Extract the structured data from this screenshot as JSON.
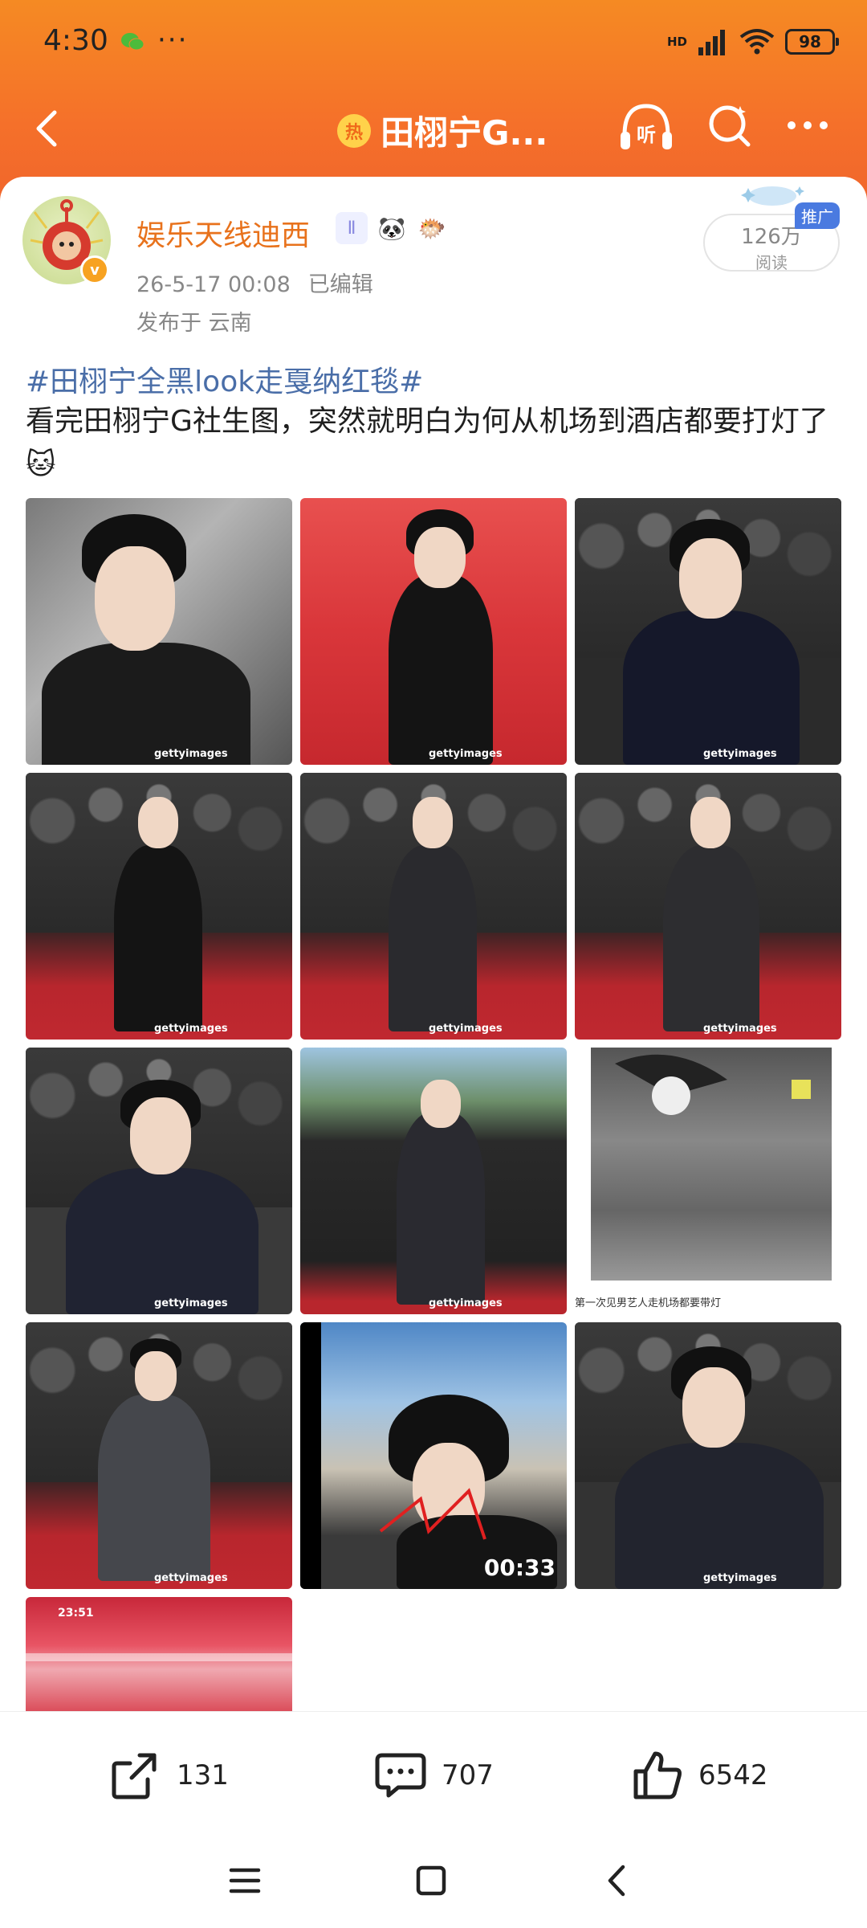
{
  "status_bar": {
    "time": "4:30",
    "dots": "···",
    "network": "HD",
    "wifi_sub": "6",
    "battery": "98"
  },
  "nav": {
    "hot_badge": "热",
    "title": "田栩宁G..."
  },
  "post": {
    "author": "娱乐天线迪西",
    "date": "26-5-17 00:08",
    "edited": "已编辑",
    "location": "发布于 云南",
    "views": "126万",
    "views_label": "阅读",
    "promo": "推广",
    "hashtag": "#田栩宁全黑look走戛纳红毯#",
    "text": "看完田栩宁G社生图，突然就明白为何从机场到酒店都要打灯了🐱",
    "images": [
      {
        "label": "gettyimages"
      },
      {
        "label": "gettyimages"
      },
      {
        "label": "gettyimages"
      },
      {
        "label": "gettyimages"
      },
      {
        "label": "gettyimages"
      },
      {
        "label": "gettyimages"
      },
      {
        "label": "gettyimages"
      },
      {
        "label": "gettyimages"
      },
      {
        "label": "第一次见男艺人走机场都要带灯"
      },
      {
        "label": "gettyimages"
      },
      {
        "label": "00:33"
      },
      {
        "label": "gettyimages"
      },
      {
        "label": "23:51"
      }
    ]
  },
  "actions": {
    "share_count": "131",
    "comment_count": "707",
    "like_count": "6542"
  },
  "colors": {
    "header_orange": "#f5702a",
    "author_orange": "#e8721c",
    "hashtag_blue": "#4a6ea8"
  }
}
